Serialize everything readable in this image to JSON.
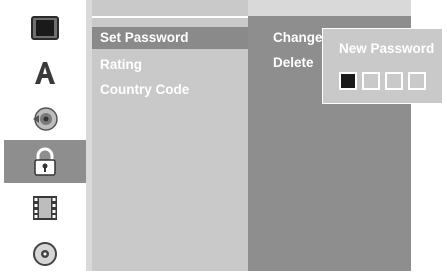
{
  "icons": [
    {
      "name": "tv-icon"
    },
    {
      "name": "language-a-icon"
    },
    {
      "name": "speaker-icon"
    },
    {
      "name": "lock-icon",
      "selected": true
    },
    {
      "name": "film-icon"
    },
    {
      "name": "disc-icon"
    }
  ],
  "menu": {
    "items": [
      {
        "label": "Set Password",
        "selected": true
      },
      {
        "label": "Rating"
      },
      {
        "label": "Country Code"
      }
    ]
  },
  "submenu": {
    "items": [
      {
        "label": "Change"
      },
      {
        "label": "Delete"
      }
    ]
  },
  "popup": {
    "title": "New Password",
    "digits_total": 4,
    "digits_entered": 1
  },
  "colors": {
    "selected_bg": "#8a8a8a",
    "menu_bg": "#c9c9c9",
    "right_bg": "#8e8e8e",
    "text": "#ffffff"
  }
}
